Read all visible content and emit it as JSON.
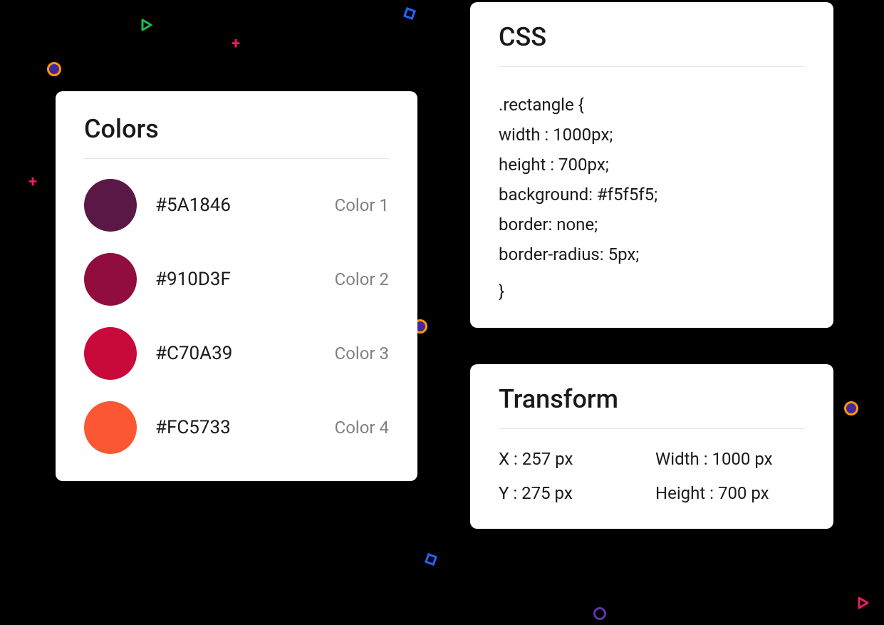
{
  "colors_panel": {
    "title": "Colors",
    "items": [
      {
        "hex": "#5A1846",
        "label": "Color 1",
        "swatch": "#5A1846"
      },
      {
        "hex": "#910D3F",
        "label": "Color 2",
        "swatch": "#910D3F"
      },
      {
        "hex": "#C70A39",
        "label": "Color 3",
        "swatch": "#C70A39"
      },
      {
        "hex": "#FC5733",
        "label": "Color 4",
        "swatch": "#FC5733"
      }
    ]
  },
  "css_panel": {
    "title": "CSS",
    "lines": [
      ".rectangle {",
      "width : 1000px;",
      "height : 700px;",
      "background: #f5f5f5;",
      "border: none;",
      "border-radius: 5px;",
      "}"
    ]
  },
  "transform_panel": {
    "title": "Transform",
    "x": "X : 257 px",
    "width": "Width : 1000 px",
    "y": "Y : 275 px",
    "height": "Height : 700 px"
  }
}
